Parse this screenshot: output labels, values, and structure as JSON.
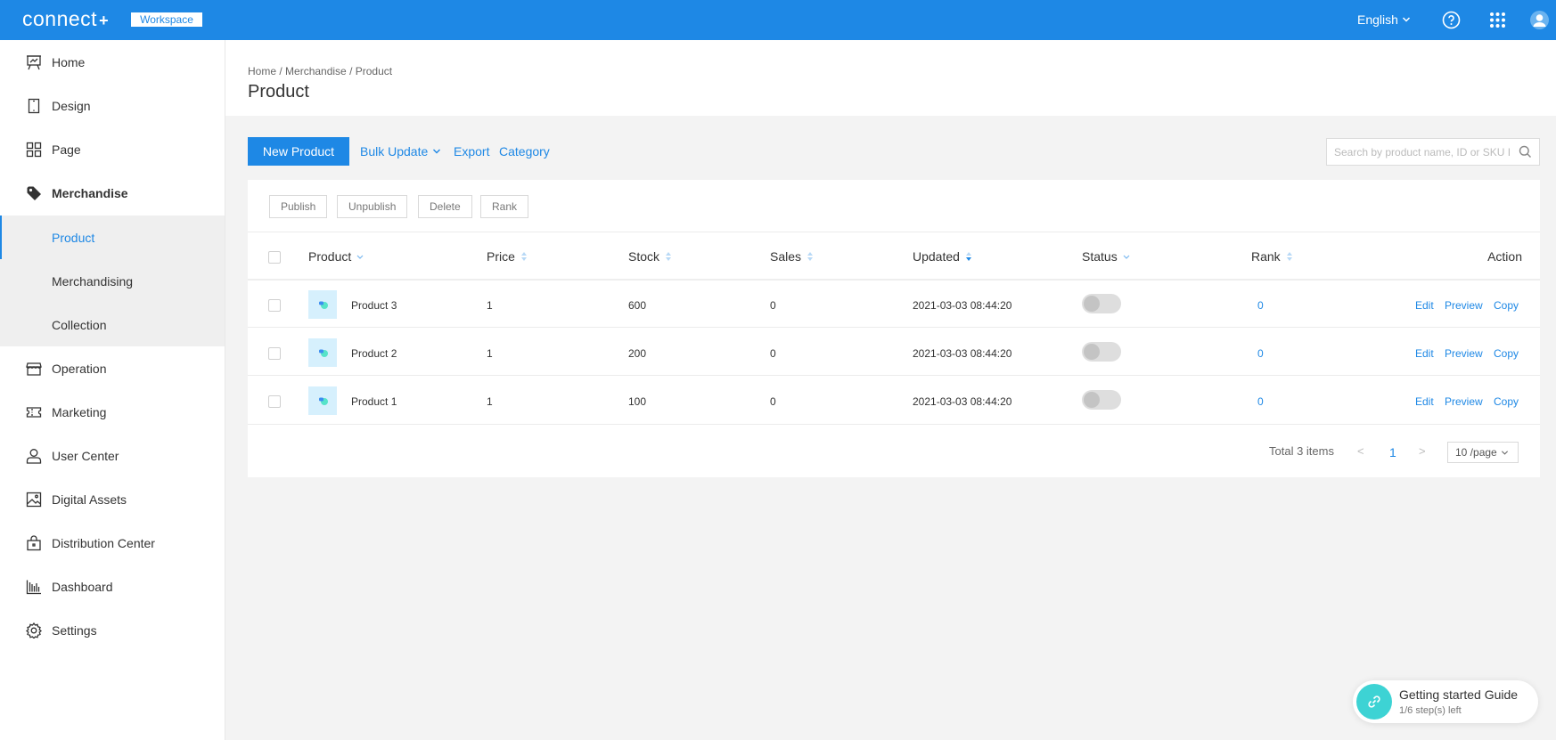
{
  "topbar": {
    "logo": "connect",
    "logo_plus": "+",
    "workspace_badge": "Workspace",
    "language": "English",
    "icons": [
      "help-icon",
      "apps-grid-icon",
      "user-avatar-icon"
    ]
  },
  "sidebar": {
    "items": [
      {
        "label": "Home",
        "icon": "presentation-board-icon"
      },
      {
        "label": "Design",
        "icon": "tablet-icon"
      },
      {
        "label": "Page",
        "icon": "grid-icon"
      },
      {
        "label": "Merchandise",
        "icon": "tag-icon"
      },
      {
        "label": "Operation",
        "icon": "store-icon"
      },
      {
        "label": "Marketing",
        "icon": "ticket-icon"
      },
      {
        "label": "User Center",
        "icon": "user-icon"
      },
      {
        "label": "Digital Assets",
        "icon": "image-icon"
      },
      {
        "label": "Distribution Center",
        "icon": "bag-icon"
      },
      {
        "label": "Dashboard",
        "icon": "bar-chart-icon"
      },
      {
        "label": "Settings",
        "icon": "gear-icon"
      }
    ],
    "sub_items": [
      {
        "label": "Product",
        "active": true
      },
      {
        "label": "Merchandising",
        "active": false
      },
      {
        "label": "Collection",
        "active": false
      }
    ]
  },
  "breadcrumb": {
    "items": [
      "Home",
      "Merchandise",
      "Product"
    ],
    "separator": " / "
  },
  "page_title": "Product",
  "toolbar": {
    "new_product": "New Product",
    "bulk_update": "Bulk Update",
    "export": "Export",
    "category": "Category",
    "search_placeholder": "Search by product name, ID or SKU ID"
  },
  "bulk_actions": [
    "Publish",
    "Unpublish",
    "Delete",
    "Rank"
  ],
  "table": {
    "columns": [
      {
        "label": "Product",
        "indicator": "filter"
      },
      {
        "label": "Price",
        "indicator": "sort"
      },
      {
        "label": "Stock",
        "indicator": "sort"
      },
      {
        "label": "Sales",
        "indicator": "sort"
      },
      {
        "label": "Updated",
        "indicator": "sort-desc-active"
      },
      {
        "label": "Status",
        "indicator": "filter"
      },
      {
        "label": "Rank",
        "indicator": "sort"
      },
      {
        "label": "Action",
        "indicator": ""
      }
    ],
    "rows": [
      {
        "name": "Product 3",
        "price": "1",
        "stock": "600",
        "sales": "0",
        "updated": "2021-03-03 08:44:20",
        "status_on": false,
        "rank": "0"
      },
      {
        "name": "Product 2",
        "price": "1",
        "stock": "200",
        "sales": "0",
        "updated": "2021-03-03 08:44:20",
        "status_on": false,
        "rank": "0"
      },
      {
        "name": "Product 1",
        "price": "1",
        "stock": "100",
        "sales": "0",
        "updated": "2021-03-03 08:44:20",
        "status_on": false,
        "rank": "0"
      }
    ],
    "row_actions": [
      "Edit",
      "Preview",
      "Copy"
    ]
  },
  "pagination": {
    "total": "Total 3 items",
    "prev": "<",
    "current_page": "1",
    "next": ">",
    "page_size": "10 /page"
  },
  "guide": {
    "title": "Getting started Guide",
    "subtitle": "1/6 step(s) left"
  },
  "colors": {
    "primary": "#1e88e5",
    "guide_accent": "#3dd3d4",
    "background": "#f3f3f3"
  }
}
